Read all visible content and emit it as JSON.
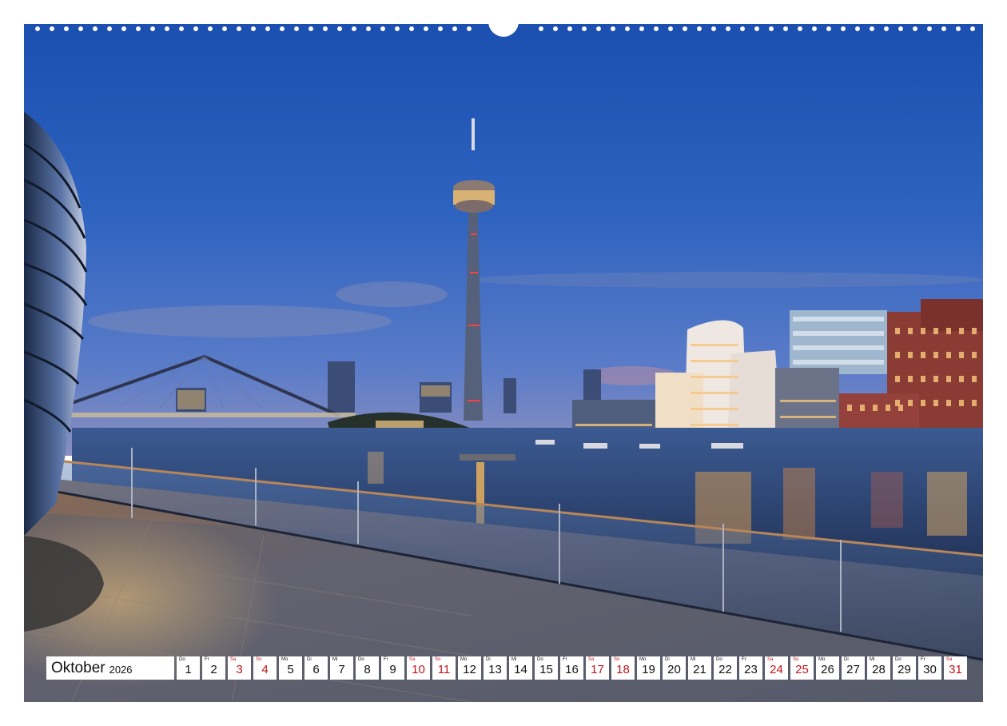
{
  "colors": {
    "sky_top": "#2259b8",
    "sky_bottom": "#6d8ccc",
    "water": "#2a3f6a",
    "light_warm": "#f3b65a",
    "weekend": "#c0151b"
  },
  "calendar": {
    "month": "Oktober",
    "year": "2026",
    "days": [
      {
        "dow": "Do",
        "num": "1",
        "weekend": false
      },
      {
        "dow": "Fr",
        "num": "2",
        "weekend": false
      },
      {
        "dow": "Sa",
        "num": "3",
        "weekend": true
      },
      {
        "dow": "So",
        "num": "4",
        "weekend": true
      },
      {
        "dow": "Mo",
        "num": "5",
        "weekend": false
      },
      {
        "dow": "Di",
        "num": "6",
        "weekend": false
      },
      {
        "dow": "Mi",
        "num": "7",
        "weekend": false
      },
      {
        "dow": "Do",
        "num": "8",
        "weekend": false
      },
      {
        "dow": "Fr",
        "num": "9",
        "weekend": false
      },
      {
        "dow": "Sa",
        "num": "10",
        "weekend": true
      },
      {
        "dow": "So",
        "num": "11",
        "weekend": true
      },
      {
        "dow": "Mo",
        "num": "12",
        "weekend": false
      },
      {
        "dow": "Di",
        "num": "13",
        "weekend": false
      },
      {
        "dow": "Mi",
        "num": "14",
        "weekend": false
      },
      {
        "dow": "Do",
        "num": "15",
        "weekend": false
      },
      {
        "dow": "Fr",
        "num": "16",
        "weekend": false
      },
      {
        "dow": "Sa",
        "num": "17",
        "weekend": true
      },
      {
        "dow": "So",
        "num": "18",
        "weekend": true
      },
      {
        "dow": "Mo",
        "num": "19",
        "weekend": false
      },
      {
        "dow": "Di",
        "num": "20",
        "weekend": false
      },
      {
        "dow": "Mi",
        "num": "21",
        "weekend": false
      },
      {
        "dow": "Do",
        "num": "22",
        "weekend": false
      },
      {
        "dow": "Fr",
        "num": "23",
        "weekend": false
      },
      {
        "dow": "Sa",
        "num": "24",
        "weekend": true
      },
      {
        "dow": "So",
        "num": "25",
        "weekend": true
      },
      {
        "dow": "Mo",
        "num": "26",
        "weekend": false
      },
      {
        "dow": "Di",
        "num": "27",
        "weekend": false
      },
      {
        "dow": "Mi",
        "num": "28",
        "weekend": false
      },
      {
        "dow": "Do",
        "num": "29",
        "weekend": false
      },
      {
        "dow": "Fr",
        "num": "30",
        "weekend": false
      },
      {
        "dow": "Sa",
        "num": "31",
        "weekend": true
      }
    ]
  }
}
